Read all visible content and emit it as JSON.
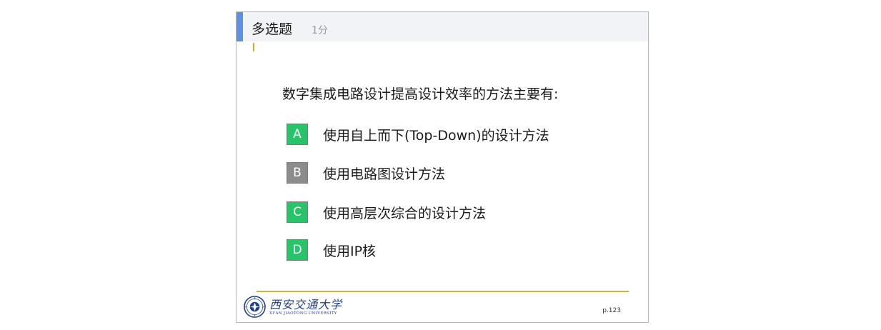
{
  "slide": {
    "header": {
      "title": "多选题",
      "score": "1分"
    },
    "question": "数字集成电路设计提高设计效率的方法主要有:",
    "options": [
      {
        "letter": "A",
        "text": "使用自上而下(Top-Down)的设计方法",
        "color": "#27c46a"
      },
      {
        "letter": "B",
        "text": "使用电路图设计方法",
        "color": "#8c8c8c"
      },
      {
        "letter": "C",
        "text": "使用高层次综合的设计方法",
        "color": "#27c46a"
      },
      {
        "letter": "D",
        "text": "使用IP核",
        "color": "#27c46a"
      }
    ],
    "footer": {
      "university_name": "西安交通大学",
      "university_name_en": "XI'AN JIAOTONG UNIVERSITY",
      "page": "p.123"
    }
  },
  "colors": {
    "header_accent": "#5b8fe8",
    "header_bg": "#f1f3f6",
    "correct": "#27c46a",
    "incorrect": "#8c8c8c",
    "footer_line": "#c9b646",
    "logo": "#1f3f8c"
  }
}
